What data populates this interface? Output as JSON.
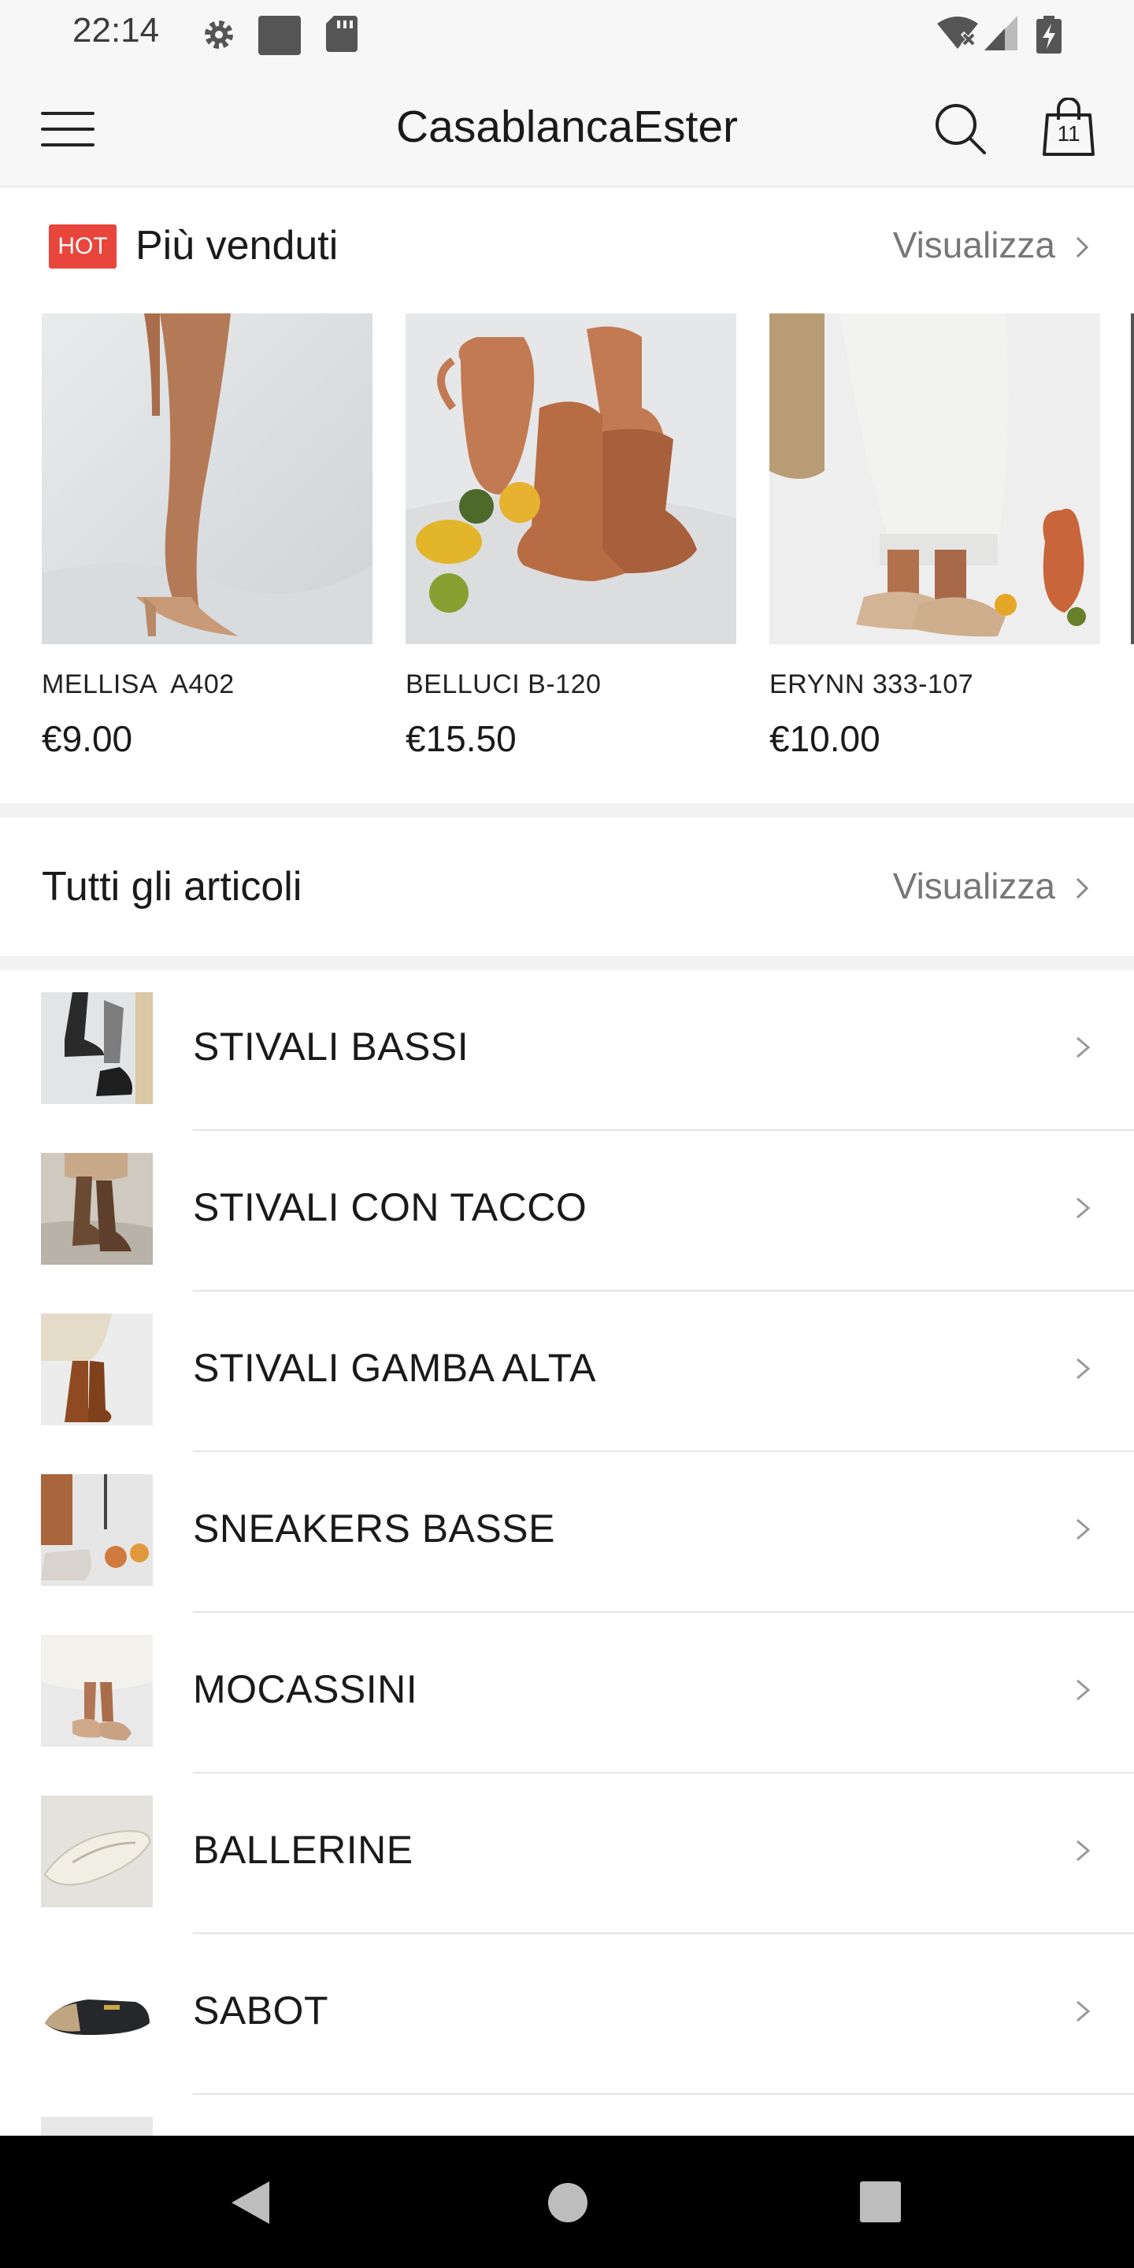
{
  "status_bar": {
    "time": "22:14"
  },
  "app_bar": {
    "title": "CasablancaEster",
    "cart_count": "11"
  },
  "best_sellers": {
    "badge": "HOT",
    "title": "Più venduti",
    "link": "Visualizza",
    "products": [
      {
        "name": "MELLISA  A402",
        "price": "€9.00"
      },
      {
        "name": "BELLUCI B-120",
        "price": "€15.50"
      },
      {
        "name": "ERYNN 333-107",
        "price": "€10.00"
      }
    ]
  },
  "all_items": {
    "title": "Tutti gli articoli",
    "link": "Visualizza"
  },
  "categories": [
    {
      "label": "STIVALI BASSI"
    },
    {
      "label": "STIVALI CON TACCO"
    },
    {
      "label": "STIVALI GAMBA ALTA"
    },
    {
      "label": "SNEAKERS BASSE"
    },
    {
      "label": "MOCASSINI"
    },
    {
      "label": "BALLERINE"
    },
    {
      "label": "SABOT"
    }
  ],
  "colors": {
    "hot_badge": "#e8453c",
    "link_gray": "#777777",
    "nav_bar": "#000000"
  }
}
